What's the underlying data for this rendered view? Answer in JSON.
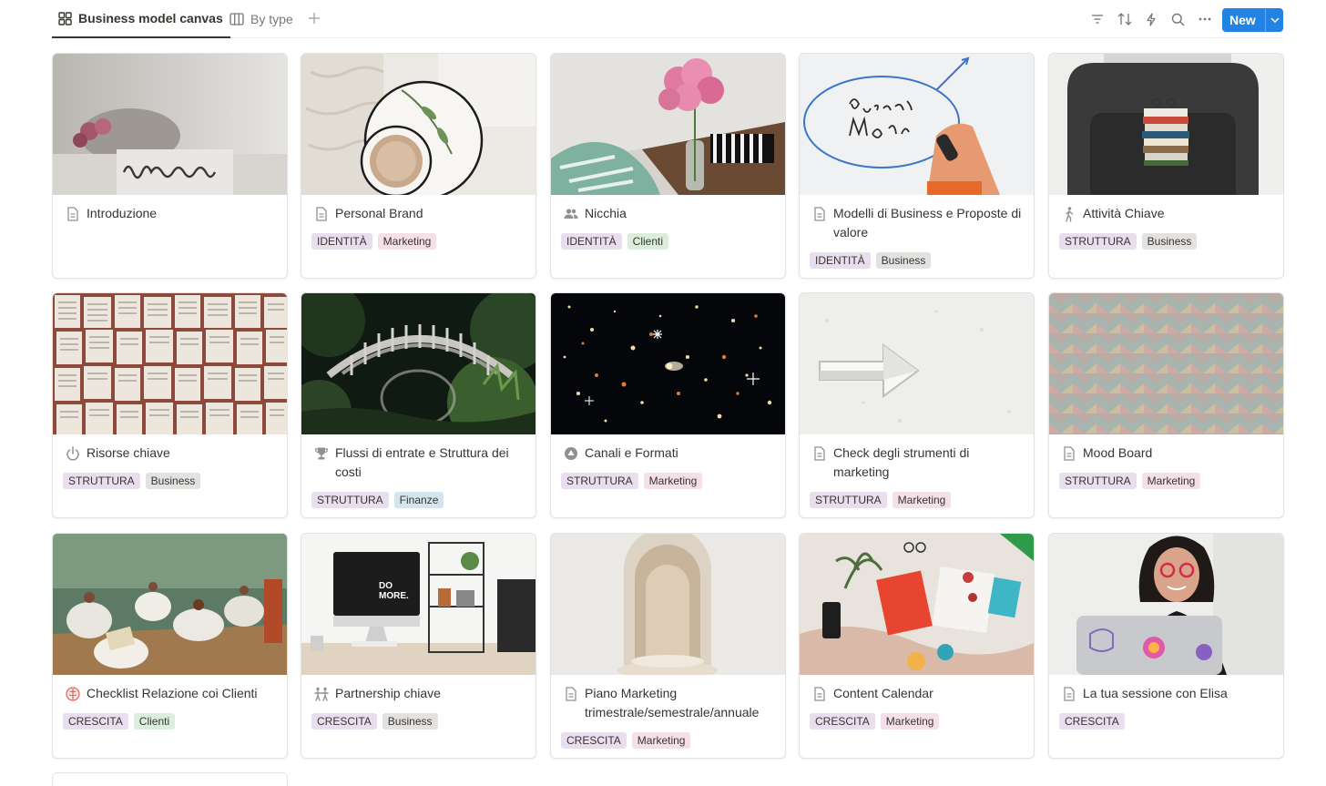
{
  "tabs": [
    {
      "label": "Business model canvas",
      "icon": "gallery-icon",
      "active": true
    },
    {
      "label": "By type",
      "icon": "board-icon",
      "active": false
    }
  ],
  "toolbar": {
    "icons": [
      "filter-icon",
      "sort-icon",
      "automation-icon",
      "search-icon",
      "more-icon"
    ],
    "new_label": "New",
    "accent": "#2383e2"
  },
  "cards": [
    {
      "title": "Introduzione",
      "icon": "page-icon",
      "tags": []
    },
    {
      "title": "Personal Brand",
      "icon": "page-icon",
      "tags": [
        {
          "label": "IDENTITÀ",
          "color": "purple"
        },
        {
          "label": "Marketing",
          "color": "pink"
        }
      ]
    },
    {
      "title": "Nicchia",
      "icon": "people-icon",
      "tags": [
        {
          "label": "IDENTITÀ",
          "color": "purple"
        },
        {
          "label": "Clienti",
          "color": "green"
        }
      ]
    },
    {
      "title": "Modelli di Business e Proposte di valore",
      "icon": "page-icon",
      "tags": [
        {
          "label": "IDENTITÀ",
          "color": "purple"
        },
        {
          "label": "Business",
          "color": "gray"
        }
      ]
    },
    {
      "title": "Attività Chiave",
      "icon": "walking-person-icon",
      "tags": [
        {
          "label": "STRUTTURA",
          "color": "purple"
        },
        {
          "label": "Business",
          "color": "gray"
        }
      ]
    },
    {
      "title": "Risorse chiave",
      "icon": "power-icon",
      "tags": [
        {
          "label": "STRUTTURA",
          "color": "purple"
        },
        {
          "label": "Business",
          "color": "gray"
        }
      ]
    },
    {
      "title": "Flussi di entrate e Struttura dei costi",
      "icon": "trophy-icon",
      "tags": [
        {
          "label": "STRUTTURA",
          "color": "purple"
        },
        {
          "label": "Finanze",
          "color": "blue"
        }
      ]
    },
    {
      "title": "Canali e Formati",
      "icon": "shapes-icon",
      "tags": [
        {
          "label": "STRUTTURA",
          "color": "purple"
        },
        {
          "label": "Marketing",
          "color": "pink"
        }
      ]
    },
    {
      "title": "Check degli strumenti di marketing",
      "icon": "page-icon",
      "tags": [
        {
          "label": "STRUTTURA",
          "color": "purple"
        },
        {
          "label": "Marketing",
          "color": "pink"
        }
      ]
    },
    {
      "title": "Mood Board",
      "icon": "page-icon",
      "tags": [
        {
          "label": "STRUTTURA",
          "color": "purple"
        },
        {
          "label": "Marketing",
          "color": "pink"
        }
      ]
    },
    {
      "title": "Checklist Relazione coi Clienti",
      "icon": "brain-icon",
      "tags": [
        {
          "label": "CRESCITA",
          "color": "purple"
        },
        {
          "label": "Clienti",
          "color": "green"
        }
      ]
    },
    {
      "title": "Partnership chiave",
      "icon": "people-group-icon",
      "tags": [
        {
          "label": "CRESCITA",
          "color": "purple"
        },
        {
          "label": "Business",
          "color": "gray"
        }
      ]
    },
    {
      "title": "Piano Marketing trimestrale/semestrale/annuale",
      "icon": "page-icon",
      "tags": [
        {
          "label": "CRESCITA",
          "color": "purple"
        },
        {
          "label": "Marketing",
          "color": "pink"
        }
      ]
    },
    {
      "title": "Content Calendar",
      "icon": "page-icon",
      "tags": [
        {
          "label": "CRESCITA",
          "color": "purple"
        },
        {
          "label": "Marketing",
          "color": "pink"
        }
      ]
    },
    {
      "title": "La tua sessione con Elisa",
      "icon": "page-icon",
      "tags": [
        {
          "label": "CRESCITA",
          "color": "purple"
        }
      ]
    }
  ]
}
